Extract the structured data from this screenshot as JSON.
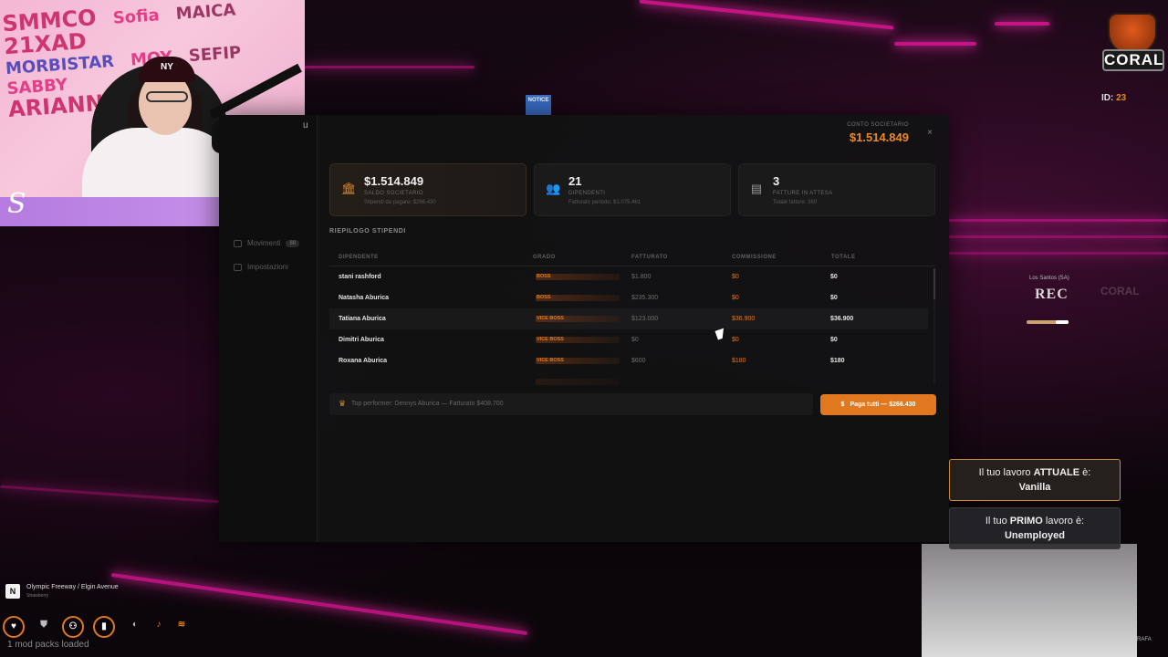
{
  "window": {
    "account_label": "CONTO SOCIETARIO",
    "account_value": "$1.514.849",
    "close_label": "×"
  },
  "sidebar": {
    "edge_label": "u",
    "items": [
      {
        "label": "Movimenti",
        "badge": "88"
      },
      {
        "label": "Impostazioni",
        "badge": ""
      }
    ]
  },
  "cards": [
    {
      "icon": "bank-icon",
      "value": "$1.514.849",
      "label": "SALDO SOCIETARIO",
      "sub": "Stipendi da pagare: $266.430"
    },
    {
      "icon": "users-icon",
      "value": "21",
      "label": "DIPENDENTI",
      "sub": "Fatturato periodo: $1.075.461"
    },
    {
      "icon": "invoice-icon",
      "value": "3",
      "label": "FATTURE IN ATTESA",
      "sub": "Totale fatture: 360"
    }
  ],
  "payroll": {
    "title": "RIEPILOGO STIPENDI",
    "columns": [
      "DIPENDENTE",
      "GRADO",
      "FATTURATO",
      "COMMISSIONE",
      "TOTALE"
    ],
    "rows": [
      {
        "name": "stani rashford",
        "rank": "BOSS",
        "fatturato": "$1.800",
        "commissione": "$0",
        "totale": "$0"
      },
      {
        "name": "Natasha Aburica",
        "rank": "BOSS",
        "fatturato": "$235.300",
        "commissione": "$0",
        "totale": "$0"
      },
      {
        "name": "Tatiana Aburica",
        "rank": "VICE BOSS",
        "fatturato": "$123.000",
        "commissione": "$36.900",
        "totale": "$36.900"
      },
      {
        "name": "Dimitri Aburica",
        "rank": "VICE BOSS",
        "fatturato": "$0",
        "commissione": "$0",
        "totale": "$0"
      },
      {
        "name": "Roxana Aburica",
        "rank": "VICE BOSS",
        "fatturato": "$600",
        "commissione": "$180",
        "totale": "$180"
      }
    ],
    "top_performer": "Top performer: Dennys Aburica — Fatturato $408.700",
    "pay_all_label": "Paga tutti — $266.430"
  },
  "hud": {
    "coral_label": "CORAL",
    "id_label": "ID:",
    "id_value": "23",
    "notice_label": "NOTICE",
    "rec_location": "Los Santos (SA)",
    "rec_label": "REC",
    "rec_coral": "CORAL",
    "rec_progress": 0.7,
    "street": "Olympic Freeway / Elgin Avenue",
    "street_sub": "Strawberry",
    "street_badge": "N",
    "mod_packs": "1 mod packs loaded",
    "corner_text": "RAFA"
  },
  "jobs": {
    "current_prefix": "Il tuo lavoro",
    "current_strong": "ATTUALE",
    "current_suffix": "è:",
    "current_value": "Vanilla",
    "primary_prefix": "Il tuo",
    "primary_strong": "PRIMO",
    "primary_suffix": "lavoro è:",
    "primary_value": "Unemployed"
  },
  "webcam": {
    "graffiti": [
      "SMMCO",
      "Sofia",
      "MAICA",
      "21XAD",
      "MORBISTAR",
      "MOY",
      "SEFIP",
      "SABBY",
      "ARIANNA"
    ],
    "cap_text": "NY",
    "signature": "S",
    "logo_letter": "S"
  },
  "colors": {
    "accent": "#e2781e",
    "neon": "#e2169a",
    "panel_bg": "#121213"
  }
}
